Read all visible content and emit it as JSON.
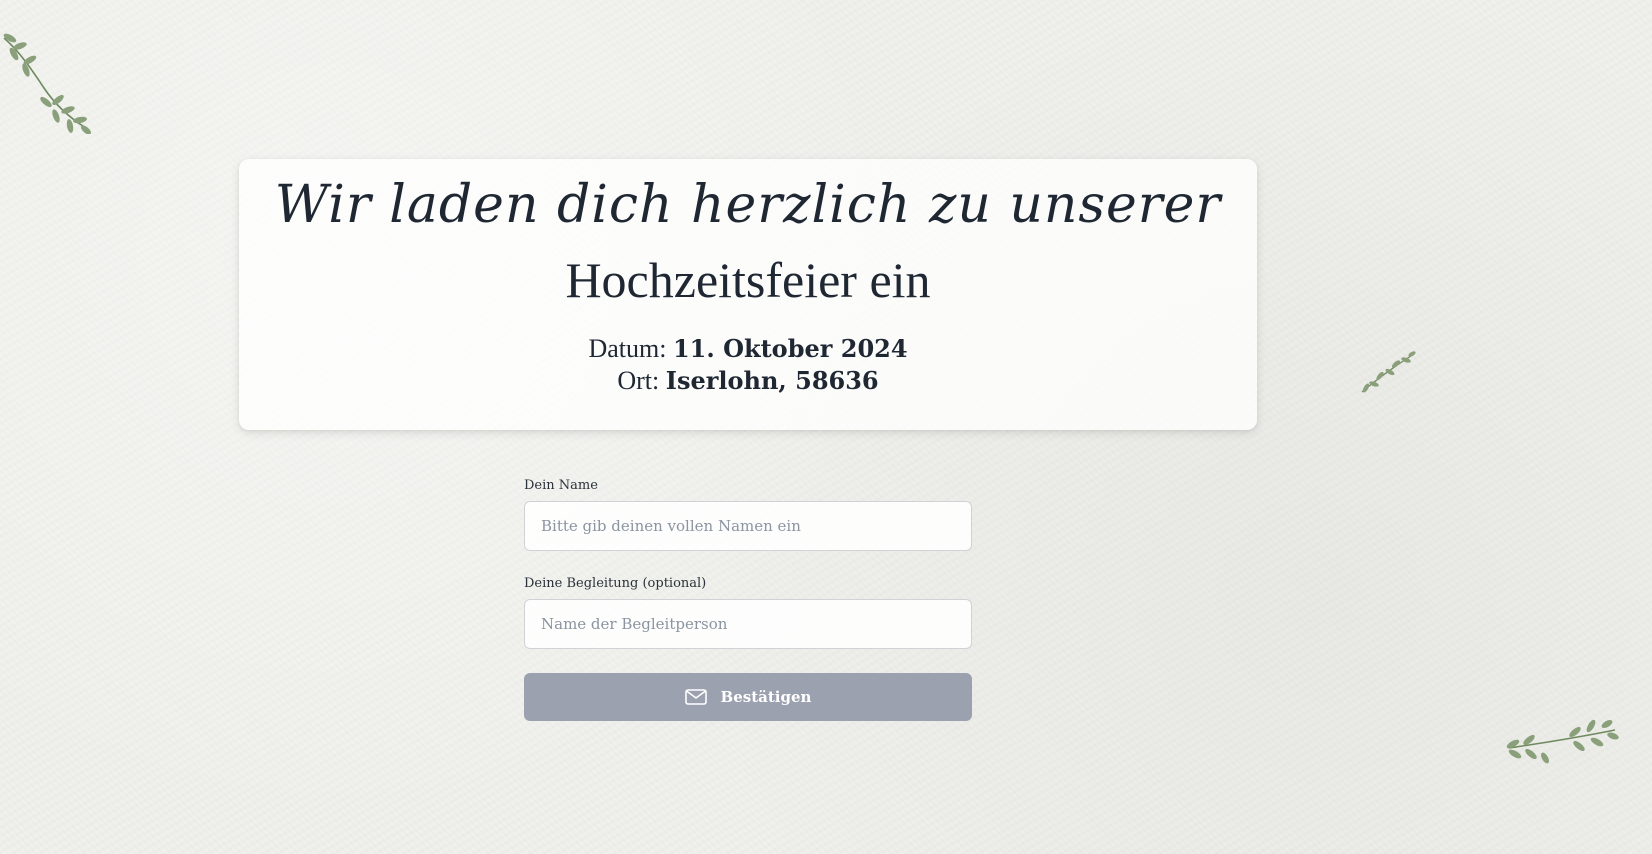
{
  "invitation": {
    "script_line": "Wir laden dich herzlich zu unserer",
    "title": "Hochzeitsfeier ein",
    "date_label": "Datum:",
    "date_value": "11. Oktober 2024",
    "place_label": "Ort:",
    "place_value": "Iserlohn, 58636"
  },
  "form": {
    "name_label": "Dein Name",
    "name_placeholder": "Bitte gib deinen vollen Namen ein",
    "name_value": "",
    "companion_label": "Deine Begleitung (optional)",
    "companion_placeholder": "Name der Begleitperson",
    "companion_value": "",
    "submit_label": "Bestätigen",
    "submit_icon": "mail-icon"
  },
  "decorations": [
    "leaf-sprig-icon",
    "leaf-sprig-icon",
    "leaf-sprig-icon"
  ],
  "colors": {
    "background": "#f0f0ec",
    "text": "#1f2733",
    "button": "#9ba1ae",
    "leaf": "#7f9670"
  }
}
